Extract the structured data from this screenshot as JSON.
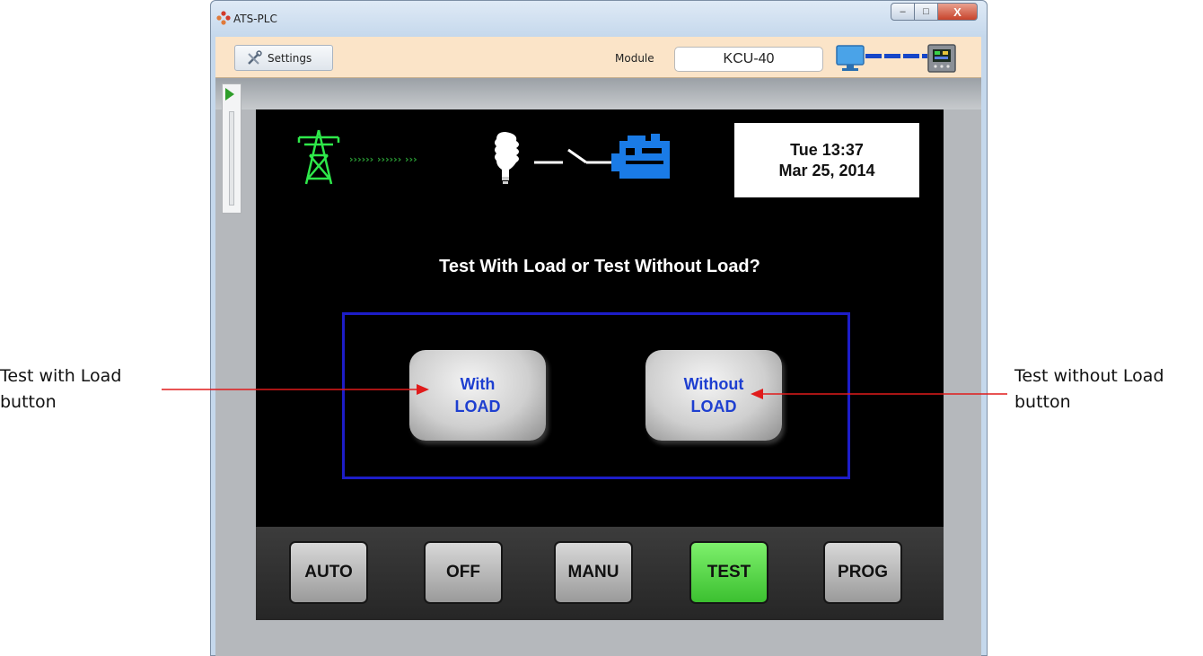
{
  "annotations": {
    "left": {
      "line1": "Test with Load",
      "line2": "button"
    },
    "right": {
      "line1": "Test without Load",
      "line2": "button"
    }
  },
  "window": {
    "title": "ATS-PLC",
    "minimize_glyph": "–",
    "maximize_glyph": "□",
    "close_glyph": "X"
  },
  "toolbar": {
    "settings_label": "Settings",
    "module_label": "Module",
    "module_value": "KCU-40"
  },
  "status": {
    "datetime_line1": "Tue 13:37",
    "datetime_line2": "Mar 25, 2014",
    "icons": [
      "transmission-tower-icon",
      "power-flow-arrows-icon",
      "lightbulb-icon",
      "open-switch-icon",
      "generator-icon"
    ]
  },
  "prompt": {
    "question": "Test With Load or Test Without Load?"
  },
  "choices": {
    "with": {
      "line1": "With",
      "line2": "LOAD"
    },
    "without": {
      "line1": "Without",
      "line2": "LOAD"
    }
  },
  "modes": {
    "auto": "AUTO",
    "off": "OFF",
    "manu": "MANU",
    "test": "TEST",
    "prog": "PROG",
    "active": "TEST"
  },
  "colors": {
    "accent_blue": "#1e3fd0",
    "box_blue": "#1d1dc8",
    "active_green": "#5fdc4c",
    "tower_green": "#2ee84a",
    "generator_blue": "#1a7be6"
  }
}
